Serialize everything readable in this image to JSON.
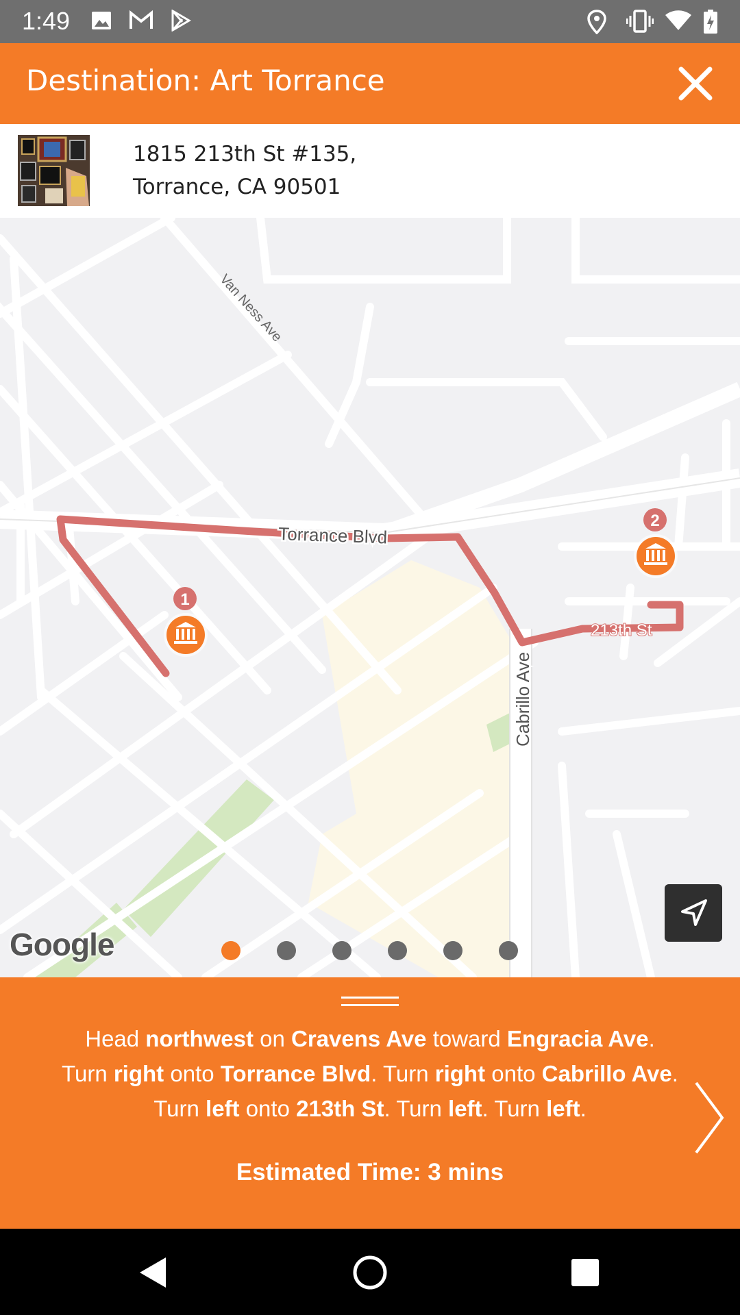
{
  "status_bar": {
    "time": "1:49",
    "left_icons": [
      "image-icon",
      "gmail-icon",
      "play-store-icon"
    ],
    "right_icons": [
      "location-icon",
      "vibrate-icon",
      "wifi-icon",
      "battery-icon"
    ]
  },
  "header": {
    "title": "Destination: Art Torrance",
    "close_icon": "close-icon",
    "color": "#f47b27"
  },
  "destination": {
    "address_line1": "1815 213th St #135,",
    "address_line2": "Torrance, CA 90501"
  },
  "map": {
    "street_labels": [
      "Van Ness Ave",
      "Torrance Blvd",
      "Cabrillo Ave",
      "213th St"
    ],
    "markers": [
      "1",
      "2"
    ],
    "marker_icon": "museum-icon",
    "route_color": "#d6716e",
    "attribution": "Google",
    "locate_icon": "navigation-arrow-icon"
  },
  "pager": {
    "count": 6,
    "active_index": 0
  },
  "directions": {
    "instruction": {
      "t0": "Head ",
      "b1": "northwest",
      "t1": " on ",
      "b2": "Cravens Ave",
      "t2": " toward ",
      "b3": "Engracia Ave",
      "t3": ". Turn ",
      "b4": "right",
      "t4": " onto ",
      "b5": "Torrance Blvd",
      "t5": ". Turn ",
      "b6": "right",
      "t6": " onto ",
      "b7": "Cabrillo Ave",
      "t7": ". Turn ",
      "b8": "left",
      "t8": " onto ",
      "b9": "213th St",
      "t9": ". Turn ",
      "b10": "left",
      "t10": ". Turn ",
      "b11": "left",
      "t11": "."
    },
    "eta": "Estimated Time: 3 mins",
    "next_icon": "chevron-right-icon"
  },
  "nav_bar": {
    "back": "back-icon",
    "home": "home-icon",
    "recents": "recents-icon"
  }
}
